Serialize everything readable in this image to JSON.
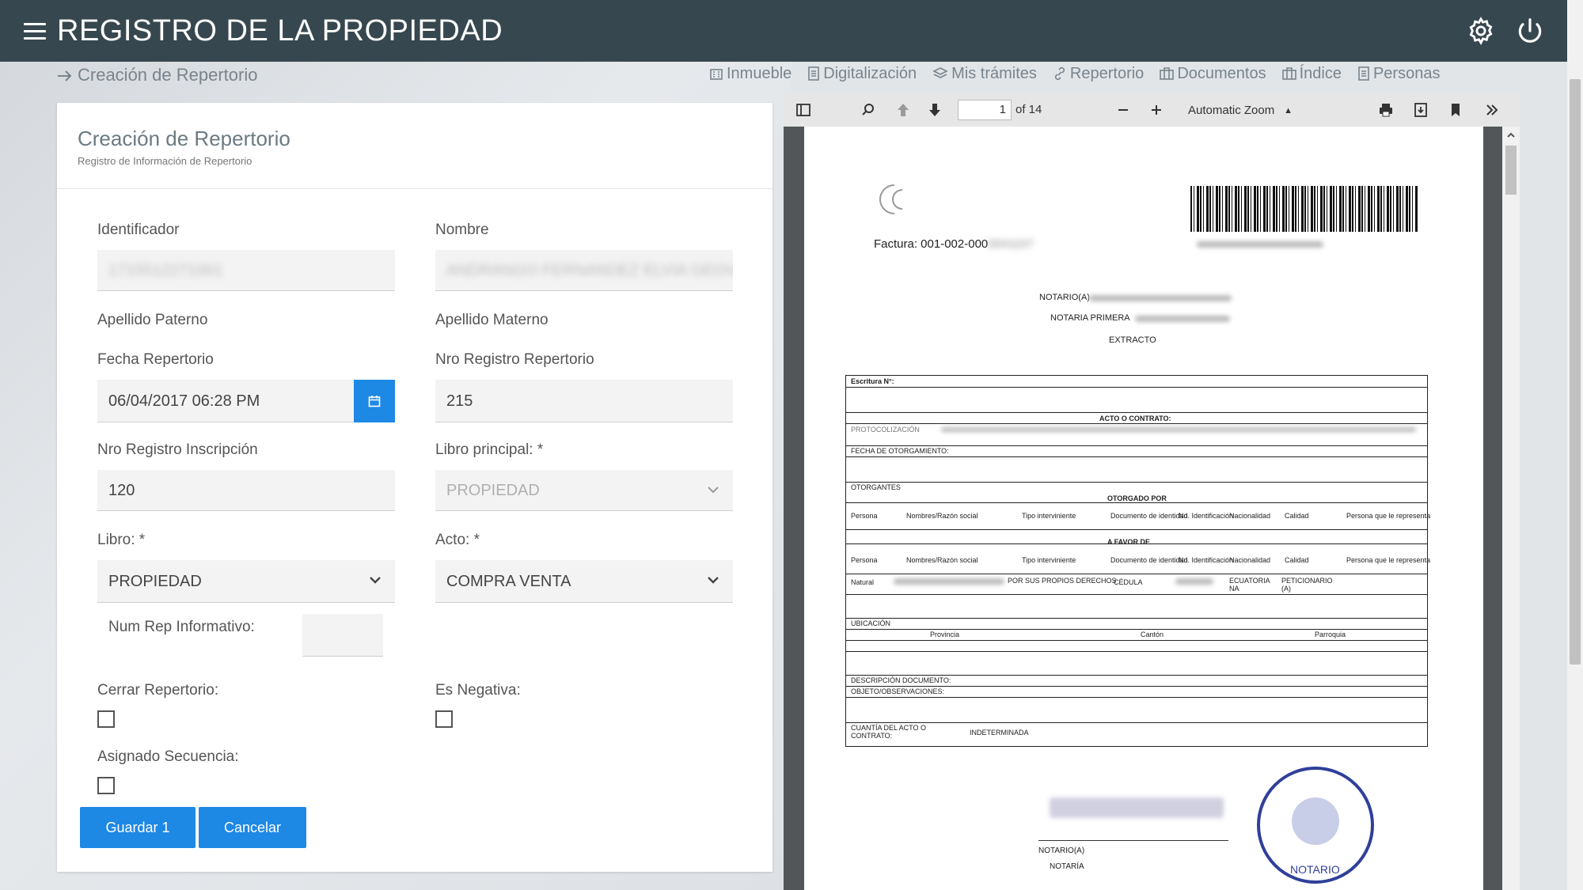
{
  "app": {
    "title": "REGISTRO DE LA PROPIEDAD"
  },
  "breadcrumb": {
    "text": "Creación de Repertorio"
  },
  "nav": [
    {
      "label": "Inmueble",
      "icon": "building-icon"
    },
    {
      "label": "Digitalización",
      "icon": "document-icon"
    },
    {
      "label": "Mis trámites",
      "icon": "layers-icon"
    },
    {
      "label": "Repertorio",
      "icon": "link-icon"
    },
    {
      "label": "Documentos",
      "icon": "briefcase-icon"
    },
    {
      "label": "Índice",
      "icon": "briefcase-icon"
    },
    {
      "label": "Personas",
      "icon": "document-icon"
    }
  ],
  "form": {
    "title": "Creación de Repertorio",
    "subtitle": "Registro de Información de Repertorio",
    "identificador_label": "Identificador",
    "identificador_value": "1715512271001",
    "nombre_label": "Nombre",
    "nombre_value": "ANDRANGO FERNANDEZ ELVIA GEOVANNA",
    "apellido_paterno_label": "Apellido Paterno",
    "apellido_materno_label": "Apellido Materno",
    "fecha_label": "Fecha Repertorio",
    "fecha_value": "06/04/2017 06:28 PM",
    "nro_registro_repertorio_label": "Nro Registro Repertorio",
    "nro_registro_repertorio_value": "215",
    "nro_registro_inscripcion_label": "Nro Registro Inscripción",
    "nro_registro_inscripcion_value": "120",
    "libro_principal_label": "Libro principal: *",
    "libro_principal_value": "PROPIEDAD",
    "libro_label": "Libro: *",
    "libro_value": "PROPIEDAD",
    "acto_label": "Acto: *",
    "acto_value": "COMPRA VENTA",
    "num_rep_label": "Num Rep Informativo:",
    "cerrar_label": "Cerrar Repertorio:",
    "negativa_label": "Es Negativa:",
    "asignado_label": "Asignado Secuencia:",
    "save_label": "Guardar 1",
    "cancel_label": "Cancelar"
  },
  "pdf": {
    "page": "1",
    "of": "of 14",
    "zoom": "Automatic Zoom",
    "doc": {
      "factura": "Factura: 001-002-000",
      "notario": "NOTARIO(A)",
      "notaria": "NOTARIA PRIMERA",
      "extracto": "EXTRACTO",
      "escritura": "Escritura N°:",
      "acto": "ACTO O CONTRATO:",
      "protocol": "PROTOCOLIZACIÓN",
      "fecha_otorg": "FECHA DE OTORGAMIENTO:",
      "otorgantes": "OTORGANTES",
      "otorgado_por": "OTORGADO POR",
      "a_favor": "A FAVOR DE",
      "cols": [
        "Persona",
        "Nombres/Razón social",
        "Tipo interviniente",
        "Documento de identidad",
        "No. Identificación",
        "Nacionalidad",
        "Calidad",
        "Persona que le representa"
      ],
      "natural": "Natural",
      "propios": "POR SUS PROPIOS DERECHOS",
      "cedula": "CÉDULA",
      "ecuatoriana": "ECUATORIA NA",
      "peticionario": "PETICIONARIO (A)",
      "ubicacion": "UBICACIÓN",
      "provincia": "Provincia",
      "canton": "Cantón",
      "parroquia": "Parroquia",
      "descripcion": "DESCRIPCIÓN DOCUMENTO:",
      "objeto": "OBJETO/OBSERVACIONES:",
      "cuantia": "CUANTÍA DEL ACTO O CONTRATO:",
      "indeterminada": "INDETERMINADA",
      "notario2": "NOTARIO(A)",
      "notaria2": "NOTARÍA",
      "stamp": "NOTARIO"
    }
  }
}
